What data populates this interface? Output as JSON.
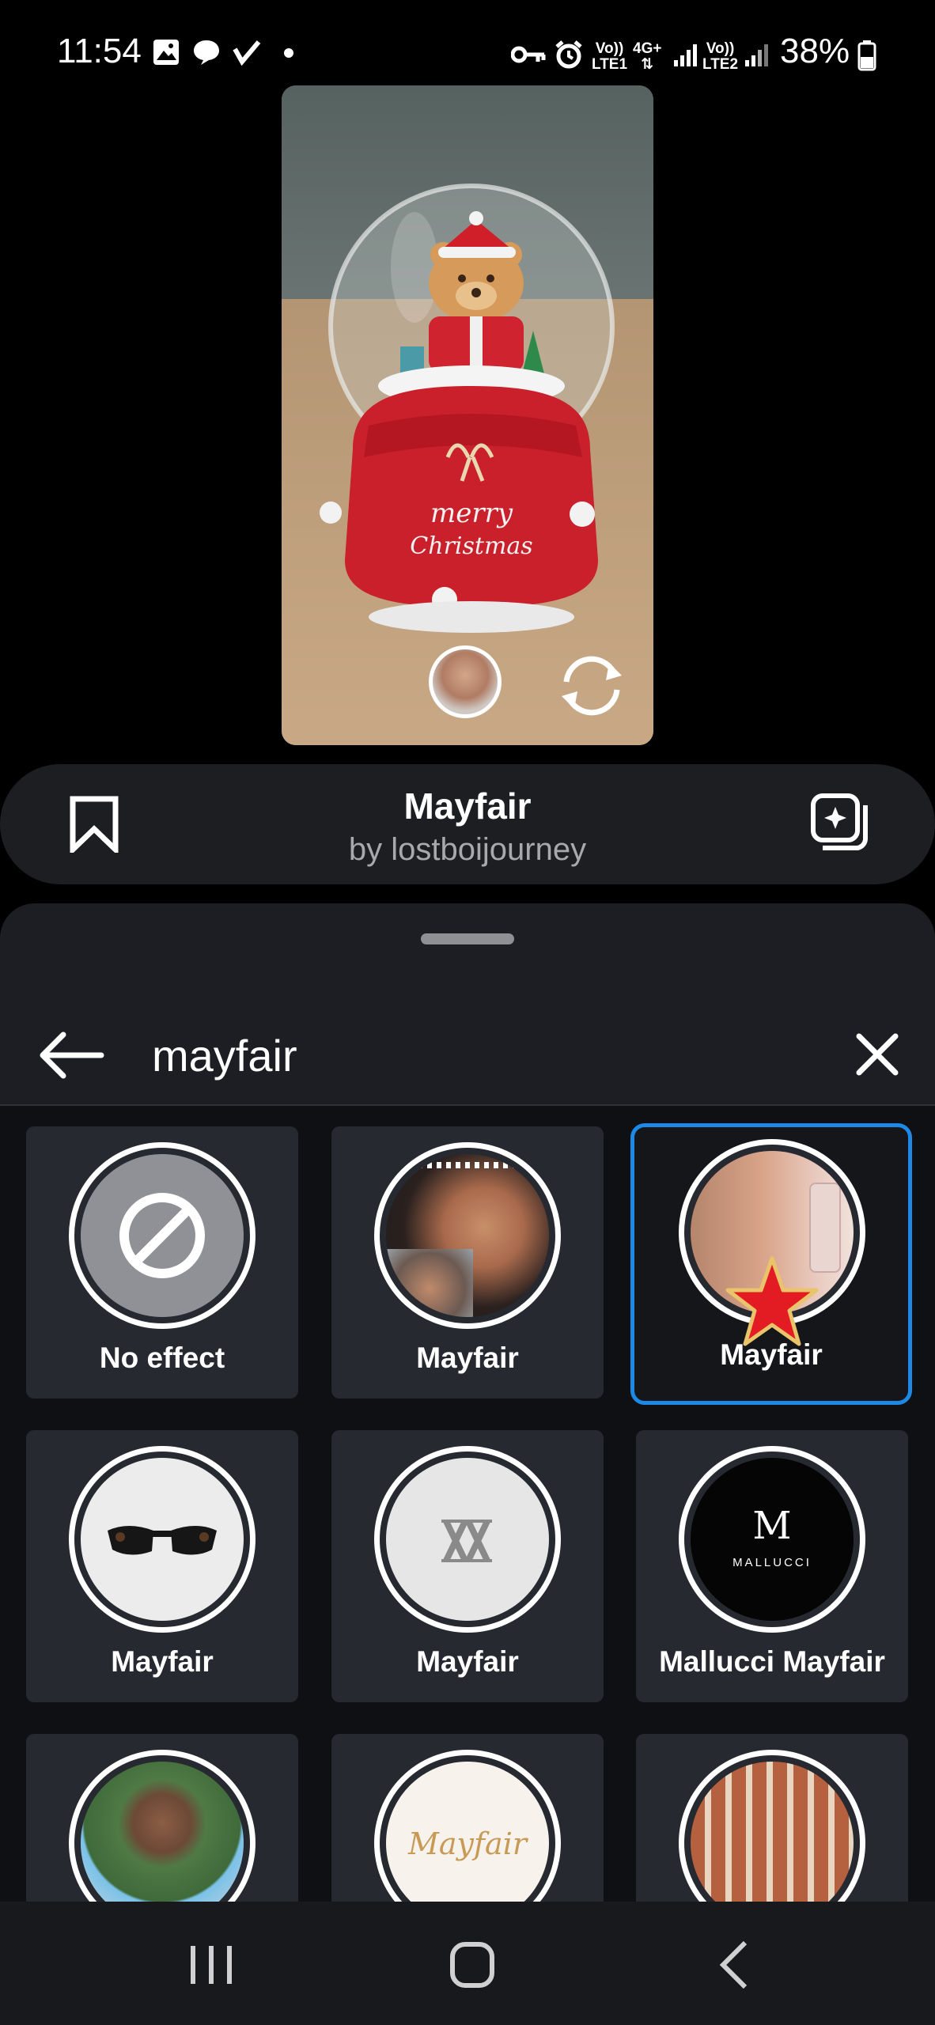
{
  "status_bar": {
    "time": "11:54",
    "battery_percent": "38%",
    "sim1_label_top": "Vo))",
    "sim1_label_bottom": "LTE1",
    "network_label_top": "4G+",
    "sim2_label_top": "Vo))",
    "sim2_label_bottom": "LTE2",
    "icons": [
      "gallery-icon",
      "chat-icon",
      "check-icon",
      "dot-icon",
      "key-icon",
      "alarm-icon",
      "signal-icon",
      "battery-icon"
    ]
  },
  "preview": {
    "snow_globe_text_line1": "merry",
    "snow_globe_text_line2": "Christmas"
  },
  "effect": {
    "title": "Mayfair",
    "author": "by lostboijourney"
  },
  "search": {
    "query": "mayfair"
  },
  "effects_grid": {
    "items": [
      {
        "label": "No effect",
        "selected": false
      },
      {
        "label": "Mayfair",
        "selected": false
      },
      {
        "label": "Mayfair",
        "selected": true
      },
      {
        "label": "Mayfair",
        "selected": false
      },
      {
        "label": "Mayfair",
        "selected": false
      },
      {
        "label": "Mallucci Mayfair",
        "selected": false
      },
      {
        "label": "",
        "selected": false
      },
      {
        "label": "",
        "selected": false
      },
      {
        "label": "",
        "selected": false
      }
    ],
    "mallucci_logo_mark": "M",
    "mallucci_logo_text": "MALLUCCI",
    "mayfair_logo_text": "Mayfair"
  },
  "colors": {
    "accent_selected": "#1e88e5",
    "tile_bg": "#26292f",
    "sheet_bg": "#1c1e23"
  }
}
